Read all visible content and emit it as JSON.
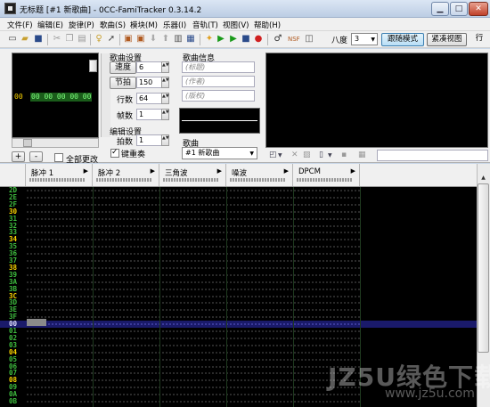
{
  "window": {
    "title": "无标题 [#1 新歌曲] - 0CC-FamiTracker 0.3.14.2",
    "min_icon": "minimize-icon",
    "max_icon": "maximize-icon",
    "close_icon": "close-icon"
  },
  "menu": [
    "文件(F)",
    "编辑(E)",
    "旋律(P)",
    "歌曲(S)",
    "模块(M)",
    "乐器(I)",
    "音轨(T)",
    "视图(V)",
    "帮助(H)"
  ],
  "toolbar": {
    "octave_label": "八度",
    "octave_value": "3",
    "follow_mode": "跟随模式",
    "compact_view": "紧凑视图",
    "more_label": "行"
  },
  "frames": {
    "row_index": "00",
    "row_cells": "00 00 00 00 00",
    "add": "+",
    "remove": "-",
    "change_all": "全部更改"
  },
  "song_settings": {
    "title": "歌曲设置",
    "speed_label": "速度",
    "speed_value": "6",
    "tempo_label": "节拍",
    "tempo_value": "150",
    "rows_label": "行数",
    "rows_value": "64",
    "frames_label": "帧数",
    "frames_value": "1"
  },
  "edit_settings": {
    "title": "编辑设置",
    "step_label": "拍数",
    "step_value": "1",
    "follow_label": "键重奏"
  },
  "song_info": {
    "title": "歌曲信息",
    "name_placeholder": "(标题)",
    "author_placeholder": "(作者)",
    "copyright_placeholder": "(版权)"
  },
  "song_selector": {
    "title": "歌曲",
    "value": "#1 新歌曲"
  },
  "channels": [
    "脉冲 1",
    "脉冲 2",
    "三角波",
    "噪波",
    "DPCM"
  ],
  "rows": [
    "2D",
    "2E",
    "2F",
    "30",
    "31",
    "32",
    "33",
    "34",
    "35",
    "36",
    "37",
    "38",
    "39",
    "3A",
    "3B",
    "3C",
    "3D",
    "3E",
    "3F",
    "00",
    "01",
    "02",
    "03",
    "04",
    "05",
    "06",
    "07",
    "08",
    "09",
    "0A",
    "0B"
  ],
  "current_row": "00",
  "colors": {
    "row_normal": "#3fbf3f",
    "row_highlight": "#ffd700",
    "row_current": "#e0e0ff",
    "accent": "#3c7fb1"
  },
  "watermark": {
    "text": "JZ5U绿色下载",
    "url": "www.jz5u.com"
  }
}
